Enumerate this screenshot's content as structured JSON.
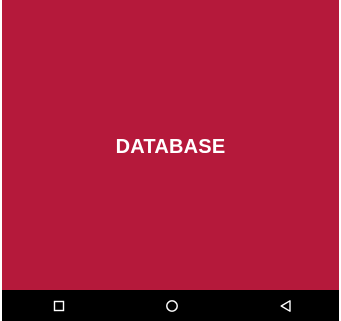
{
  "splash": {
    "title": "DATABASE",
    "background_color": "#b5193b",
    "title_color": "#ffffff"
  },
  "navigation_bar": {
    "background_color": "#000000",
    "icon_color": "#ffffff",
    "buttons": [
      {
        "id": "recents",
        "icon": "square-recents-icon"
      },
      {
        "id": "home",
        "icon": "circle-home-icon"
      },
      {
        "id": "back",
        "icon": "triangle-back-icon"
      }
    ]
  }
}
